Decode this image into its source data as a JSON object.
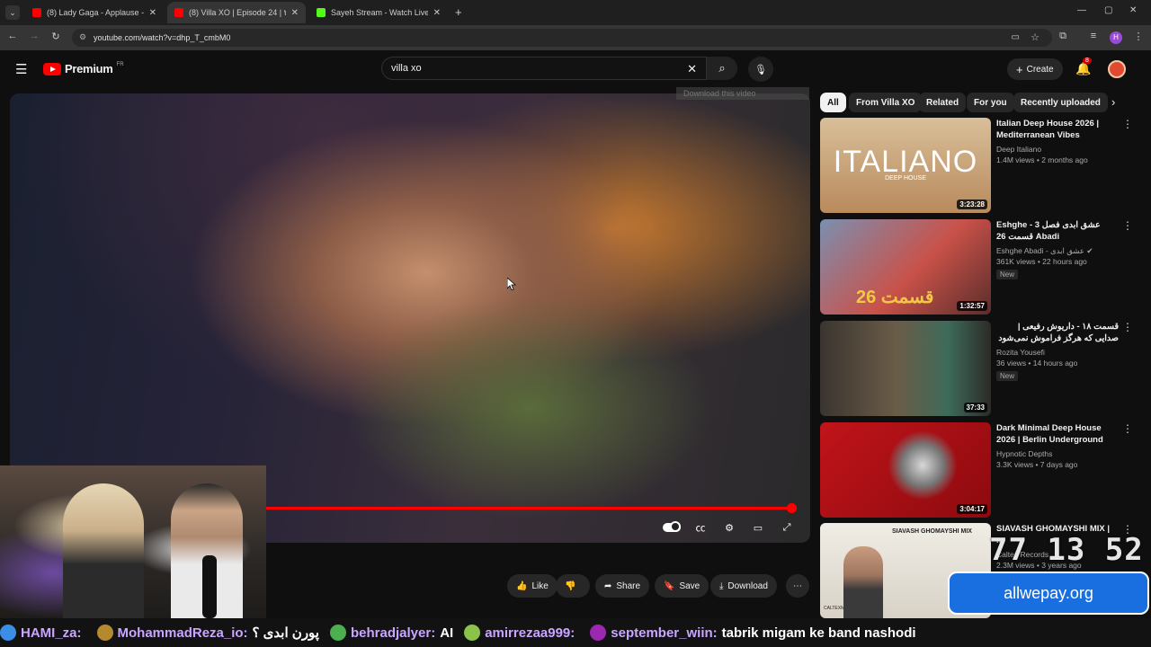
{
  "browser": {
    "tabs": [
      {
        "title": "(8) Lady Gaga - Applause - You",
        "color": "#ff0000"
      },
      {
        "title": "(8) Villa XO | Episode 24 | ۲۴ قسمت",
        "color": "#ff0000"
      },
      {
        "title": "Sayeh Stream - Watch Live on K",
        "color": "#53fc18"
      }
    ],
    "new_tab": "+",
    "url": "youtube.com/watch?v=dhp_T_cmbM0",
    "profile_initial": "H"
  },
  "header": {
    "logo_text": "Premium",
    "logo_region": "FR",
    "search_value": "villa xo",
    "create_label": "Create",
    "notif_count": "8"
  },
  "player": {
    "progress": 0.99,
    "download_overlay": "Download this video",
    "cursor": "cursor"
  },
  "actions": {
    "like": "Like",
    "share": "Share",
    "save": "Save",
    "download": "Download"
  },
  "chips": [
    "All",
    "From Villa XO",
    "Related",
    "For you",
    "Recently uploaded"
  ],
  "recommendations": [
    {
      "title": "Italian Deep House 2026 | Mediterranean Vibes",
      "channel": "Deep Italiano",
      "meta": "1.4M views • 2 months ago",
      "duration": "3:23:28",
      "badge": "",
      "thumb_text": "ITALIANO",
      "thumb_sub": "DEEP HOUSE",
      "thumb_bg": "#c9a57a"
    },
    {
      "title": "Eshghe - عشق ابدی فصل 3 قسمت 26 Abadi",
      "channel": "Eshghe Abadi - عشق ابدی",
      "meta": "361K views • 22 hours ago",
      "duration": "1:32:57",
      "badge": "New",
      "thumb_text": "قسمت 26",
      "thumb_sub": "",
      "thumb_bg": "#c9524a"
    },
    {
      "title": "قسمت ۱۸ - داریوش رفیعی | صدایی که هرگز فراموش نمی‌شود",
      "channel": "Rozita Yousefi",
      "meta": "36 views • 14 hours ago",
      "duration": "37:33",
      "badge": "New",
      "thumb_text": "",
      "thumb_sub": "",
      "thumb_bg": "#5b5346"
    },
    {
      "title": "Dark Minimal Deep House 2026 | Berlin Underground Late Nigh...",
      "channel": "Hypnotic Depths",
      "meta": "3.3K views • 7 days ago",
      "duration": "3:04:17",
      "badge": "",
      "thumb_text": "",
      "thumb_sub": "",
      "thumb_bg": "#b21116"
    },
    {
      "title": "SIAVASH GHOMAYSHI MIX | ...",
      "channel": "Caltex Records",
      "meta": "2.3M views • 3 years ago",
      "duration": "",
      "badge": "",
      "thumb_text": "SIAVASH GHOMAYSHI MIX",
      "thumb_sub": "CALTEXMUSIC",
      "thumb_bg": "#e9e6df"
    }
  ],
  "overlay": {
    "clock": "77 13 52",
    "sponsor": "allwepay.org"
  },
  "ticker": [
    {
      "user": "HAMI_za:",
      "msg": ""
    },
    {
      "user": "MohammadReza_io:",
      "msg": "پورن ابدی ؟"
    },
    {
      "user": "behradjalyer:",
      "msg": "AI"
    },
    {
      "user": "amirrezaa999:",
      "msg": ""
    },
    {
      "user": "september_wiin:",
      "msg": "tabrik migam ke band nashodi"
    }
  ],
  "colors": {
    "accent": "#ff0000",
    "bg": "#0f0f0f",
    "chip": "#272727"
  }
}
